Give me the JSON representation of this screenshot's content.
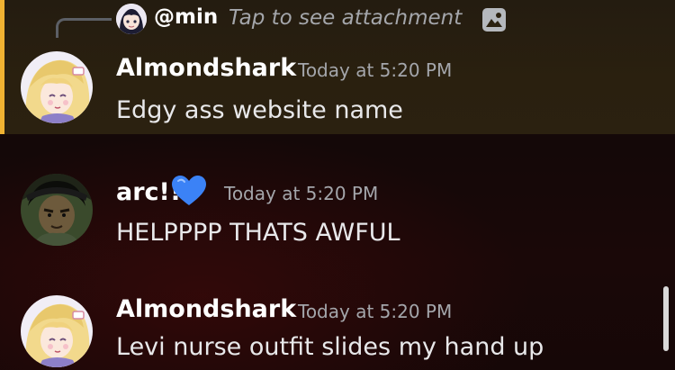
{
  "reply": {
    "mention": "@min",
    "preview": "Tap to see attachment",
    "avatar_icon": "anime-avatar",
    "attachment_icon": "image-icon"
  },
  "messages": [
    {
      "author": "Almondshark",
      "timestamp": "Today at 5:20 PM",
      "text": "Edgy ass website name",
      "highlighted": true
    },
    {
      "author": "arc!!",
      "author_emoji": "blue-heart",
      "timestamp": "Today at 5:20 PM",
      "text": "HELPPPP THATS AWFUL",
      "highlighted": false
    },
    {
      "author": "Almondshark",
      "timestamp": "Today at 5:20 PM",
      "text": "Levi nurse outfit slides my hand up",
      "highlighted": false
    }
  ],
  "colors": {
    "mention_bar": "#f0b232",
    "highlight_bg": "#2a200f",
    "timestamp": "#a4a6ab",
    "reply_text": "#a4a6ab",
    "heart": "#3b82f6"
  }
}
